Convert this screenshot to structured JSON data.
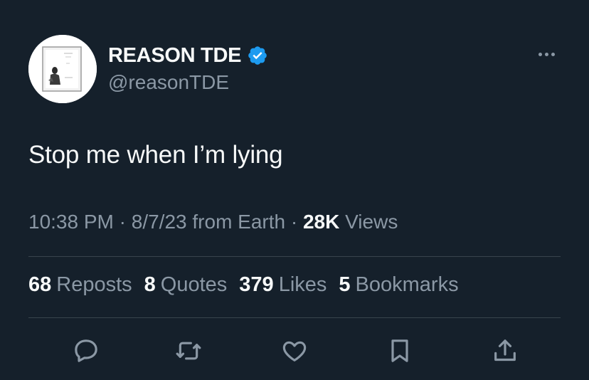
{
  "author": {
    "display_name": "REASON TDE",
    "handle": "@reasonTDE",
    "verified_icon": "verified-badge-icon",
    "verified_color": "#1d9bf0"
  },
  "tweet": {
    "text": "Stop me when I’m lying"
  },
  "meta": {
    "time": "10:38 PM",
    "separator": " · ",
    "date": "8/7/23",
    "source": " from Earth",
    "separator2": " · ",
    "views_count": "28K",
    "views_label": " Views"
  },
  "stats": {
    "reposts": {
      "count": "68",
      "label": "Reposts"
    },
    "quotes": {
      "count": "8",
      "label": "Quotes"
    },
    "likes": {
      "count": "379",
      "label": "Likes"
    },
    "bookmarks": {
      "count": "5",
      "label": "Bookmarks"
    }
  },
  "actions": [
    "reply-icon",
    "repost-icon",
    "like-icon",
    "bookmark-icon",
    "share-icon"
  ],
  "colors": {
    "background": "#15202b",
    "primary_text": "#f7f9f9",
    "secondary_text": "#8b98a5",
    "divider": "#38444d"
  }
}
